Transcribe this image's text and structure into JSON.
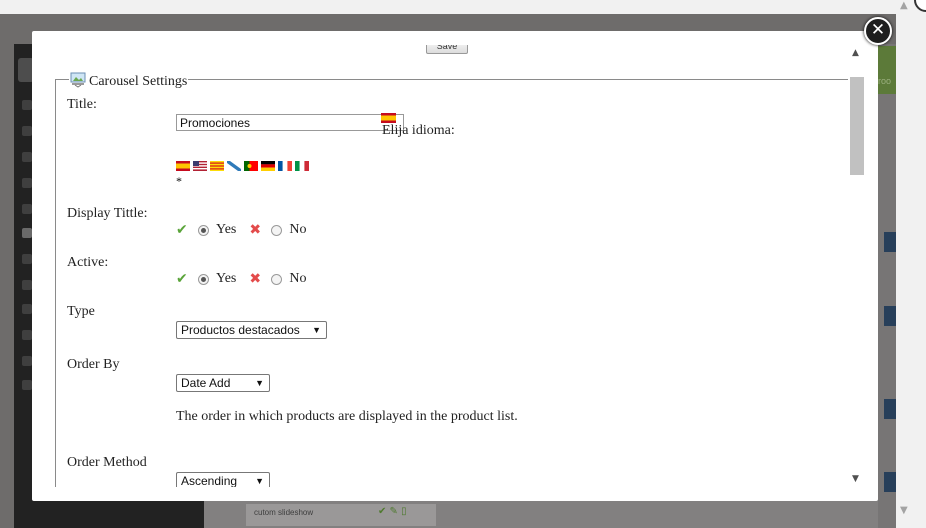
{
  "modal": {
    "top_button_label": "Save",
    "close_symbol": "✕",
    "section_title": "Carousel Settings"
  },
  "form": {
    "title": {
      "label": "Title:",
      "value": "Promociones",
      "language_label": "Elija idioma:",
      "required_mark": "*"
    },
    "language_flags": [
      "es-flag-icon",
      "us-flag-icon",
      "ca-flag-icon",
      "gl-flag-icon",
      "pt-flag-icon",
      "de-flag-icon",
      "fr-flag-icon",
      "it-flag-icon"
    ],
    "display_title": {
      "label": "Display Tittle:",
      "yes": "Yes",
      "no": "No",
      "selected": "Yes"
    },
    "active": {
      "label": "Active:",
      "yes": "Yes",
      "no": "No",
      "selected": "Yes"
    },
    "type": {
      "label": "Type",
      "value": "Productos destacados"
    },
    "order_by": {
      "label": "Order By",
      "value": "Date Add",
      "help": "The order in which products are displayed in the product list."
    },
    "order_method": {
      "label": "Order Method",
      "value": "Ascending"
    }
  },
  "background": {
    "item_label": "cutom slideshow",
    "green_text": "roo"
  },
  "colors": {
    "accent_check": "#5aa43a",
    "accent_cross": "#e34b4b",
    "overlay": "#6e6c6b"
  }
}
